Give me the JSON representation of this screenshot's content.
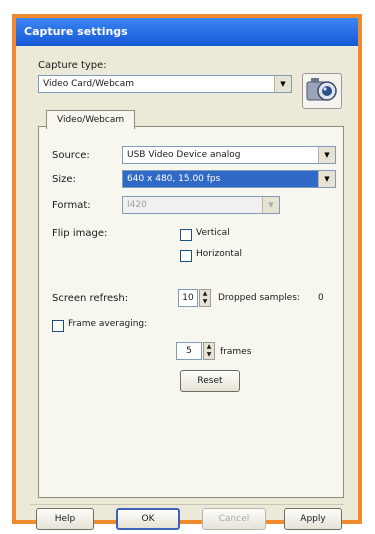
{
  "window": {
    "title": "Capture settings"
  },
  "capture_type": {
    "label": "Capture type:",
    "value": "Video Card/Webcam"
  },
  "tab": {
    "label": "Video/Webcam"
  },
  "source": {
    "label": "Source:",
    "value": "USB Video Device analog"
  },
  "size": {
    "label": "Size:",
    "value": "640 x 480, 15.00 fps"
  },
  "format": {
    "label": "Format:",
    "value": "I420"
  },
  "flip": {
    "label": "Flip image:",
    "vertical_label": "Vertical",
    "horizontal_label": "Horizontal"
  },
  "screen_refresh": {
    "label": "Screen refresh:",
    "value": "10",
    "dropped_label": "Dropped samples:",
    "dropped_value": "0"
  },
  "frame_averaging": {
    "label": "Frame averaging:",
    "value": "5",
    "unit": "frames",
    "reset_label": "Reset"
  },
  "buttons": {
    "help": "Help",
    "ok": "OK",
    "cancel": "Cancel",
    "apply": "Apply"
  },
  "icons": {
    "camera": "webcam-icon",
    "dropdown": "chevron-down-icon"
  }
}
